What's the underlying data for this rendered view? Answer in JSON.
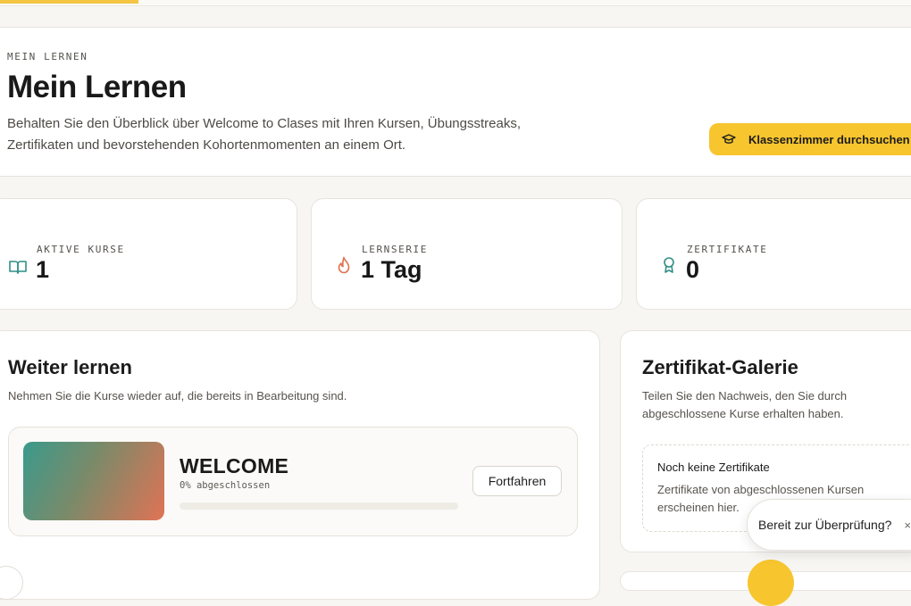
{
  "header": {
    "eyebrow": "MEIN LERNEN",
    "title": "Mein Lernen",
    "description_line1": "Behalten Sie den Überblick über Welcome to Clases mit Ihren Kursen, Übungsstreaks,",
    "description_line2": "Zertifikaten und bevorstehenden Kohortenmomenten an einem Ort.",
    "primary_action": "Klassenzimmer durchsuchen"
  },
  "stats": [
    {
      "label": "AKTIVE KURSE",
      "value": "1",
      "icon": "book-open-icon"
    },
    {
      "label": "LERNSERIE",
      "value": "1 Tag",
      "icon": "flame-icon"
    },
    {
      "label": "ZERTIFIKATE",
      "value": "0",
      "icon": "award-icon"
    }
  ],
  "continue": {
    "title": "Weiter lernen",
    "subtitle": "Nehmen Sie die Kurse wieder auf, die bereits in Bearbeitung sind.",
    "course": {
      "name": "WELCOME",
      "progress_text": "0% abgeschlossen",
      "progress": 0,
      "action": "Fortfahren"
    }
  },
  "gallery": {
    "title": "Zertifikat-Galerie",
    "subtitle_line1": "Teilen Sie den Nachweis, den Sie durch",
    "subtitle_line2": "abgeschlossene Kurse erhalten haben.",
    "empty_title": "Noch keine Zertifikate",
    "empty_desc": "Zertifikate von abgeschlossenen Kursen erscheinen hier."
  },
  "toast": {
    "text": "Bereit zur Überprüfung?",
    "close": "×"
  },
  "colors": {
    "accent": "#f7c52e",
    "teal": "#2f8f86",
    "flame": "#e0724f"
  }
}
